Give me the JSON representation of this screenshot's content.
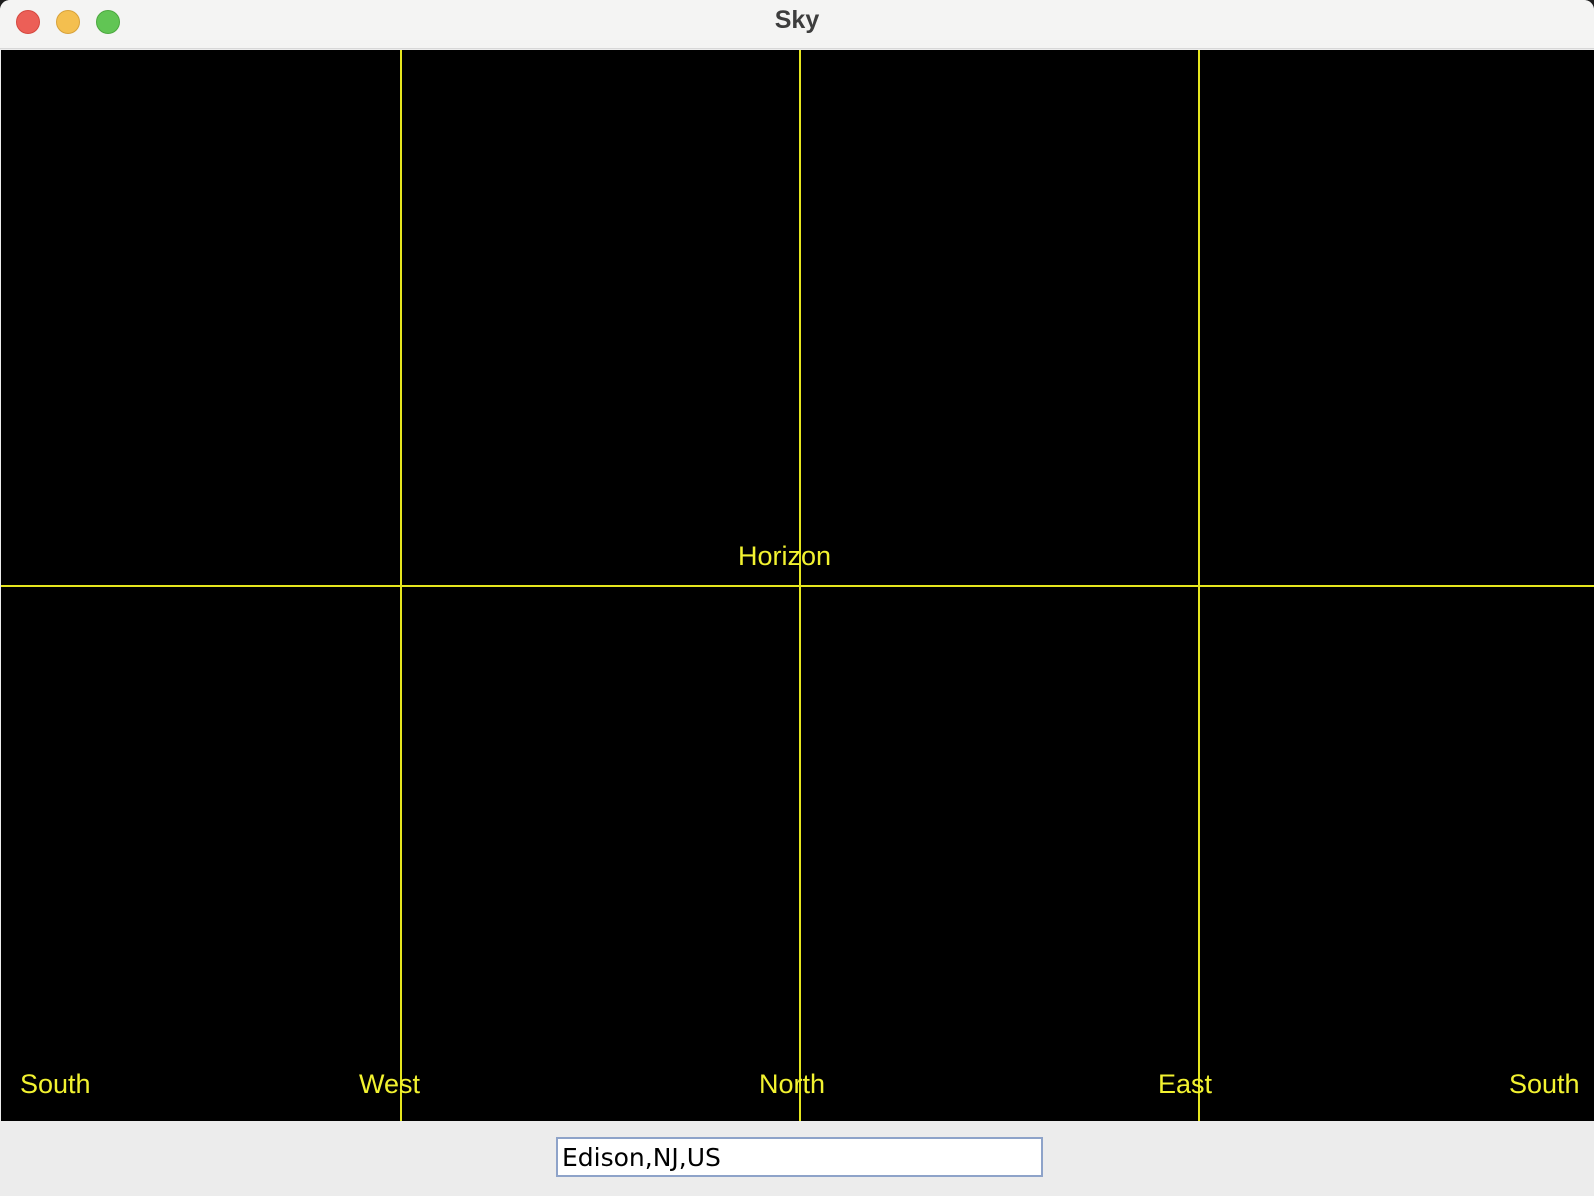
{
  "window": {
    "title": "Sky"
  },
  "sky": {
    "horizon_label": "Horizon",
    "direction_labels": [
      "South",
      "West",
      "North",
      "East",
      "South"
    ],
    "line_color": "#e6e61e",
    "background_color": "#000000"
  },
  "location": {
    "value": "Edison,NJ,US"
  }
}
